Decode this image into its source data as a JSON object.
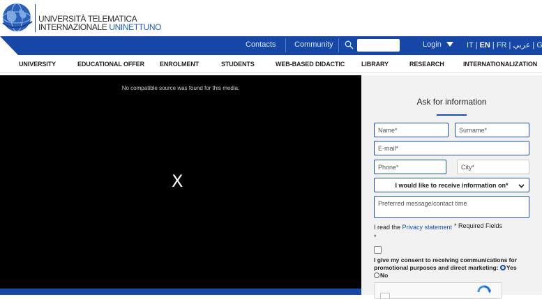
{
  "header": {
    "logo_line1": "UNIVERSITÀ TELEMATICA",
    "logo_line2_a": "INTERNAZIONALE ",
    "logo_line2_b": "UNINETTUNO"
  },
  "topbar": {
    "contacts": "Contacts",
    "community": "Community",
    "search_placeholder": "",
    "login": "Login",
    "lang_it": "IT",
    "lang_en": "EN",
    "lang_fr": "FR",
    "lang_ar": "عربي",
    "lang_gr": "GR"
  },
  "nav": {
    "items": [
      "UNIVERSITY",
      "EDUCATIONAL OFFER",
      "ENROLMENT",
      "STUDENTS",
      "WEB-BASED DIDACTIC",
      "LIBRARY",
      "RESEARCH",
      "INTERNATIONALIZATION"
    ]
  },
  "video": {
    "message": "No compatible source was found for this media.",
    "close": "X"
  },
  "form": {
    "title": "Ask for information",
    "name": "Name*",
    "surname": "Surname*",
    "email": "E-mail*",
    "phone": "Phone*",
    "city": "City*",
    "select": "I would like to receive information on*",
    "message": "Preferred message/contact time",
    "read_the": "I read the ",
    "privacy": "Privacy statement",
    "required_star": "*",
    "required": " Required Fields",
    "asterisk": "*",
    "consent_line1": "I give my consent to receiving communications for",
    "consent_line2": "promotional purposes and direct marketing:",
    "yes": "Yes",
    "no": "No"
  },
  "colors": {
    "brand_blue": "#1747a6",
    "accent": "#1a4fb0"
  }
}
